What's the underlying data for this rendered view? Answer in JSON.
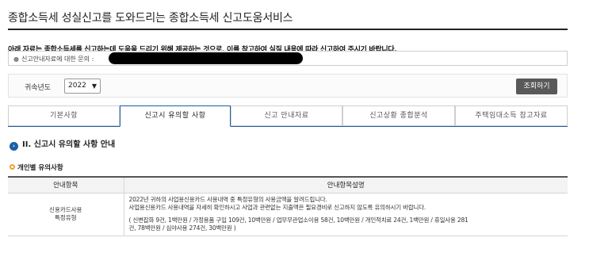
{
  "page": {
    "title": "종합소득세 성실신고를 도와드리는 종합소득세 신고도움서비스"
  },
  "notice": {
    "text": "아래 자료는 종합소득세를 신고하는데 도움을 드리기 위해 제공하는 것으로, 이를 참고하여 실질 내용에 따라 신고하여 주시기 바랍니다.",
    "contact_bullet": "●",
    "contact_label": "신고안내자료에 대한 문의 :"
  },
  "filter": {
    "year_label": "귀속년도",
    "year_value": "2022",
    "caret": "▼",
    "search_button": "조회하기"
  },
  "tabs": [
    {
      "label": "기본사항"
    },
    {
      "label": "신고시 유의할 사항"
    },
    {
      "label": "신고 안내자료"
    },
    {
      "label": "신고상황 종합분석"
    },
    {
      "label": "주택임대소득 참고자료"
    }
  ],
  "section": {
    "icon": "›",
    "title": "II. 신고시 유의할 사항 안내"
  },
  "subsection": {
    "title": "개인별 유의사항"
  },
  "table": {
    "headers": [
      "안내항목",
      "안내항목설명"
    ],
    "rows": [
      {
        "item_line1": "신용카드사용",
        "item_line2": "특정유형",
        "desc_line1": "2022년 귀하의 사업용신용카드 사용내역 중 특정유형의 사용금액을 알려드립니다.",
        "desc_line2": "사업용신용카드 사용내역을 자세히 확인하시고 사업과 관련없는 지출액은 필요경비로 신고하지 않도록 유의하시기 바랍니다.",
        "desc_line3": "( 신변잡화 9건, 1백만원 / 가정용품 구입 109건, 10백만원 / 업무무관업소이용 58건, 10백만원 / 개인적치료 24건, 1백만원 / 휴일사용 281",
        "desc_line4": "건, 78백만원 / 심야사용 274건, 30백만원 )"
      }
    ]
  },
  "colors": {
    "accent_blue": "#1c5fa8",
    "button_gray": "#595959",
    "sub_icon_orange": "#f0a030"
  }
}
